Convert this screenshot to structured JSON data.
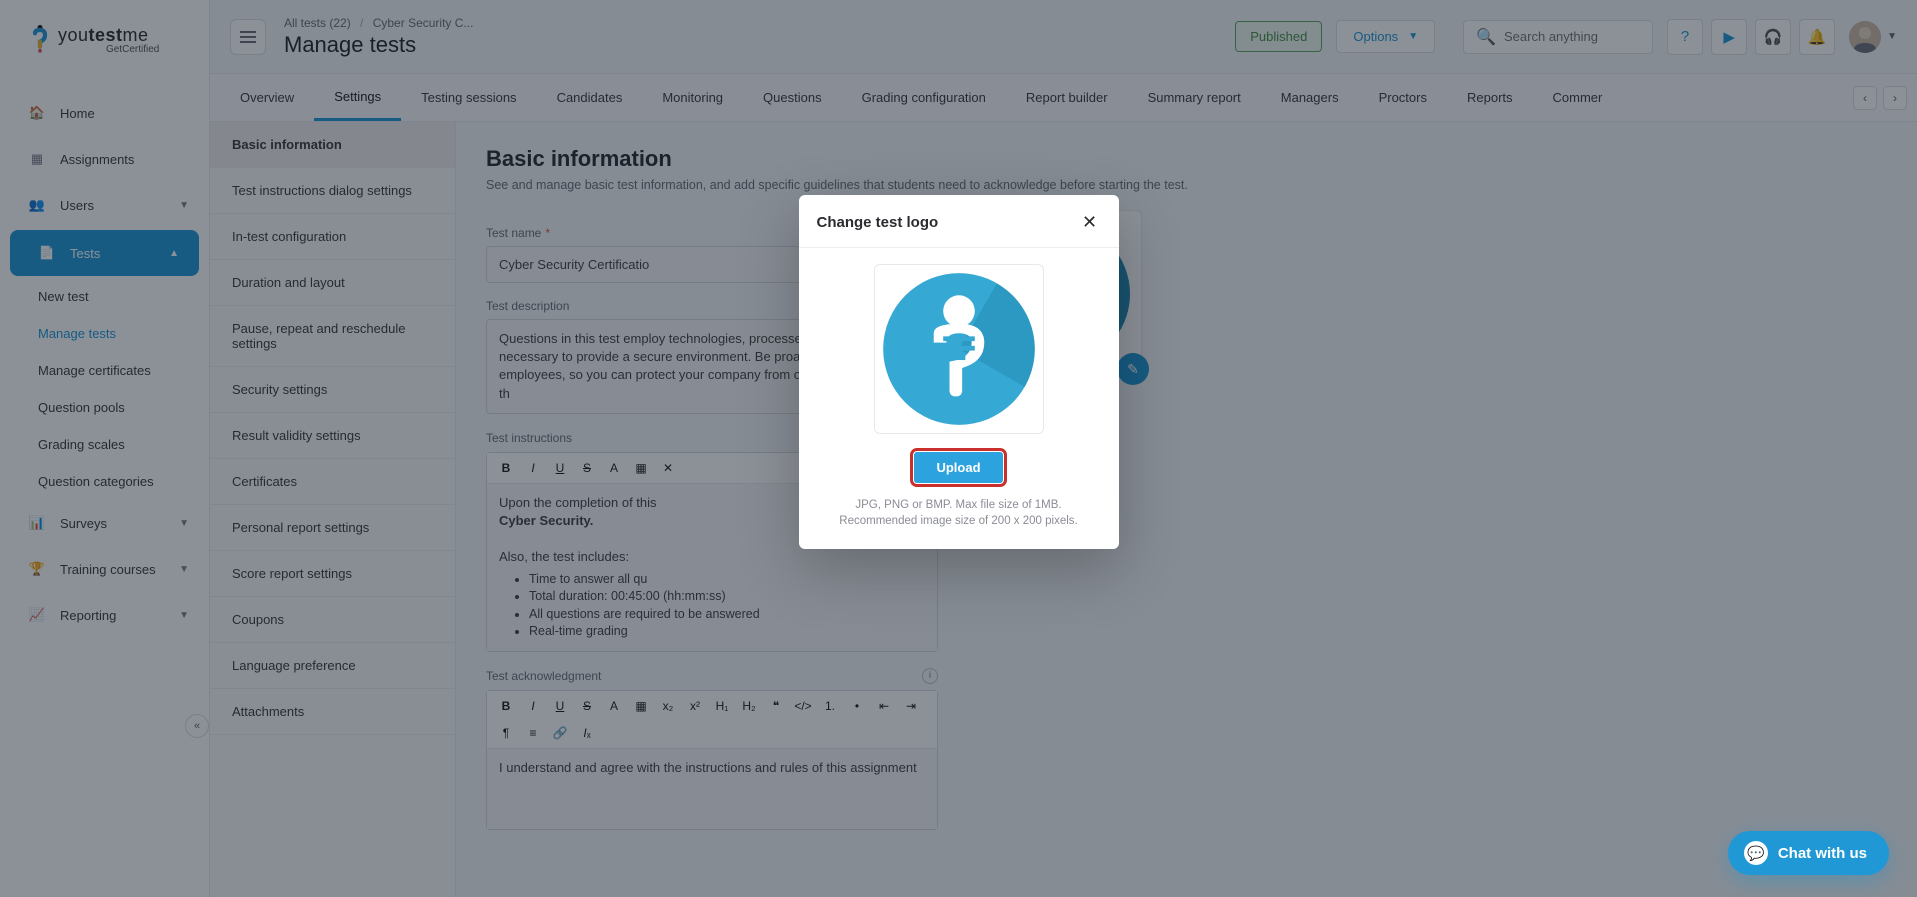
{
  "brand": {
    "part1": "you",
    "part2": "test",
    "part3": "me",
    "sub": "GetCertified"
  },
  "left_nav": {
    "home": "Home",
    "assignments": "Assignments",
    "users": "Users",
    "tests": "Tests",
    "tests_children": {
      "new_test": "New test",
      "manage_tests": "Manage tests",
      "manage_certificates": "Manage certificates",
      "question_pools": "Question pools",
      "grading_scales": "Grading scales",
      "question_categories": "Question categories"
    },
    "surveys": "Surveys",
    "training": "Training courses",
    "reporting": "Reporting"
  },
  "header": {
    "breadcrumb_all_tests": "All tests (22)",
    "breadcrumb_current": "Cyber Security C...",
    "page_title": "Manage tests",
    "status": "Published",
    "options": "Options",
    "search_placeholder": "Search anything"
  },
  "tabs": [
    "Overview",
    "Settings",
    "Testing sessions",
    "Candidates",
    "Monitoring",
    "Questions",
    "Grading configuration",
    "Report builder",
    "Summary report",
    "Managers",
    "Proctors",
    "Reports",
    "Commer"
  ],
  "active_tab_index": 1,
  "settings_sidebar": [
    "Basic information",
    "Test instructions dialog settings",
    "In-test configuration",
    "Duration and layout",
    "Pause, repeat and reschedule settings",
    "Security settings",
    "Result validity settings",
    "Certificates",
    "Personal report settings",
    "Score report settings",
    "Coupons",
    "Language preference",
    "Attachments"
  ],
  "active_setting_index": 0,
  "form": {
    "heading": "Basic information",
    "subheading": "See and manage basic test information, and add specific guidelines that students need to acknowledge before starting the test.",
    "test_name_label": "Test name",
    "test_name_value": "Cyber Security Certificatio",
    "test_description_label": "Test description",
    "test_description_value": "Questions in this test employ technologies, processes, and services necessary to provide a secure environment. Be proactive and test your employees, so you can protect your company from ongoing and emerging th",
    "test_instructions_label": "Test instructions",
    "instructions_line1": "Upon the completion of this",
    "instructions_bold": "Cyber Security.",
    "instructions_also": "Also, the test includes:",
    "instructions_bullets": [
      "Time to answer all qu",
      "Total duration: 00:45:00 (hh:mm:ss)",
      "All questions are required to be answered",
      "Real-time grading"
    ],
    "ack_label": "Test acknowledgment",
    "ack_value": "I understand and agree with the instructions and rules of this assignment"
  },
  "modal": {
    "title": "Change test logo",
    "upload": "Upload",
    "hint": "JPG, PNG or BMP. Max file size of 1MB. Recommended image size of 200 x 200 pixels."
  },
  "chat": {
    "label": "Chat with us"
  },
  "colors": {
    "accent": "#1f98d5"
  }
}
